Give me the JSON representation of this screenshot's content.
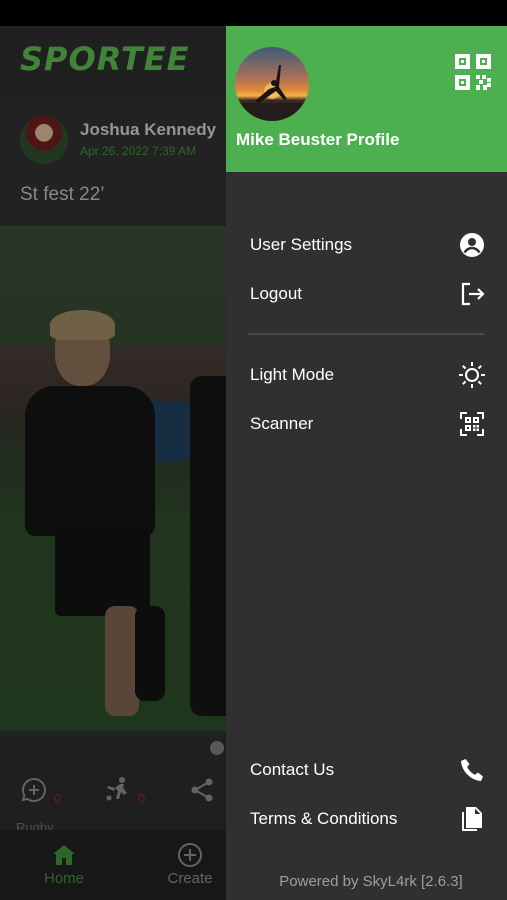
{
  "app": {
    "logo": "SPORTEE",
    "post": {
      "author": "Joshua Kennedy",
      "timestamp": "Apr 26, 2022 7:39 AM",
      "caption": "St fest 22’",
      "actions": [
        {
          "icon": "comment-add-icon",
          "count": "0"
        },
        {
          "icon": "kick-icon",
          "count": "0"
        },
        {
          "icon": "share-icon",
          "count": ""
        }
      ],
      "tag": "Rugby"
    },
    "bottom_nav": [
      {
        "label": "Home",
        "icon": "home-icon",
        "active": true
      },
      {
        "label": "Create",
        "icon": "add-circle-icon",
        "active": false
      }
    ]
  },
  "drawer": {
    "profile_name": "Mike Beuster Profile",
    "qr_icon": "qr-code-icon",
    "menu": [
      {
        "label": "User Settings",
        "icon": "account-circle-icon"
      },
      {
        "label": "Logout",
        "icon": "logout-icon"
      },
      {
        "label": "Light Mode",
        "icon": "sun-icon"
      },
      {
        "label": "Scanner",
        "icon": "qr-scanner-icon"
      },
      {
        "label": "Contact Us",
        "icon": "phone-icon"
      },
      {
        "label": "Terms & Conditions",
        "icon": "documents-icon"
      }
    ],
    "footer": "Powered by SkyL4rk [2.6.3]"
  },
  "colors": {
    "brand_green": "#4caf50",
    "drawer_bg": "#303030",
    "active_nav": "#3d8f36",
    "count_red": "#8c2a20"
  }
}
